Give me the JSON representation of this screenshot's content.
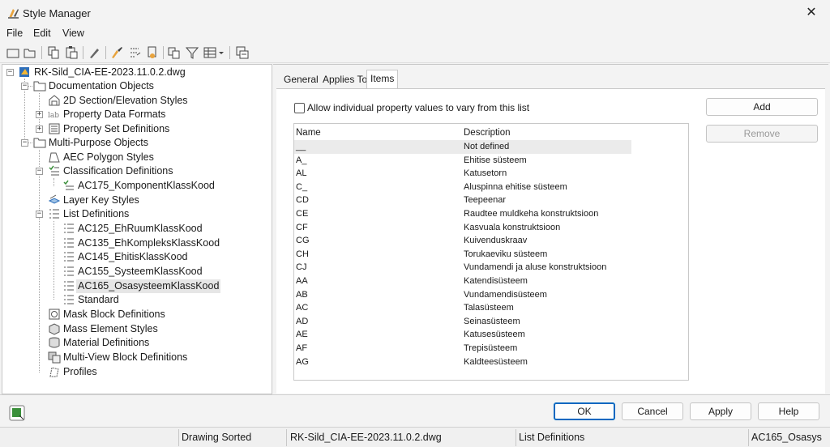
{
  "window": {
    "title": "Style Manager",
    "close_glyph": "✕"
  },
  "menu": [
    "File",
    "Edit",
    "View"
  ],
  "toolbar": {
    "icons": [
      "new-drawing-icon",
      "open-drawing-icon",
      "copy-icon",
      "paste-icon",
      "edit-style-icon",
      "purge-icon",
      "toggle-view-icon",
      "sort-icon",
      "filter-icon",
      "view-list-icon",
      "chevron-down-icon",
      "inline-edit-icon"
    ]
  },
  "tree": {
    "root": "RK-Sild_CIA-EE-2023.11.0.2.dwg",
    "doc_objects": "Documentation Objects",
    "section_styles": "2D Section/Elevation Styles",
    "property_data_formats": "Property Data Formats",
    "property_set_defs": "Property Set Definitions",
    "multi_purpose": "Multi-Purpose Objects",
    "aec_polygon": "AEC Polygon Styles",
    "classification": "Classification Definitions",
    "ac175": "AC175_KomponentKlassKood",
    "layer_key": "Layer Key Styles",
    "list_defs": "List Definitions",
    "ac125": "AC125_EhRuumKlassKood",
    "ac135": "AC135_EhKompleksKlassKood",
    "ac145": "AC145_EhitisKlassKood",
    "ac155": "AC155_SysteemKlassKood",
    "ac165": "AC165_OsasysteemKlassKood",
    "standard": "Standard",
    "mask_block": "Mask Block Definitions",
    "mass_element": "Mass Element Styles",
    "material_defs": "Material Definitions",
    "multi_view": "Multi-View Block Definitions",
    "profiles": "Profiles"
  },
  "tabs": {
    "general": "General",
    "applies_to": "Applies To",
    "items": "Items"
  },
  "items_panel": {
    "checkbox_label": "Allow individual property values to vary from this list",
    "add_label": "Add",
    "remove_label": "Remove",
    "col_name": "Name",
    "col_desc": "Description",
    "rows": [
      {
        "name": "__",
        "desc": "Not defined"
      },
      {
        "name": "A_",
        "desc": "Ehitise süsteem"
      },
      {
        "name": "AL",
        "desc": "Katusetorn"
      },
      {
        "name": "C_",
        "desc": "Aluspinna ehitise süsteem"
      },
      {
        "name": "CD",
        "desc": "Teepeenar"
      },
      {
        "name": "CE",
        "desc": "Raudtee muldkeha konstruktsioon"
      },
      {
        "name": "CF",
        "desc": "Kasvuala konstruktsioon"
      },
      {
        "name": "CG",
        "desc": "Kuivenduskraav"
      },
      {
        "name": "CH",
        "desc": "Torukaeviku süsteem"
      },
      {
        "name": "CJ",
        "desc": "Vundamendi ja aluse konstruktsioon"
      },
      {
        "name": "AA",
        "desc": "Katendisüsteem"
      },
      {
        "name": "AB",
        "desc": "Vundamendisüsteem"
      },
      {
        "name": "AC",
        "desc": "Talasüsteem"
      },
      {
        "name": "AD",
        "desc": "Seinasüsteem"
      },
      {
        "name": "AE",
        "desc": "Katusesüsteem"
      },
      {
        "name": "AF",
        "desc": "Trepisüsteem"
      },
      {
        "name": "AG",
        "desc": "Kaldteesüsteem"
      }
    ]
  },
  "buttons": {
    "ok": "OK",
    "cancel": "Cancel",
    "apply": "Apply",
    "help": "Help"
  },
  "status": {
    "sort": "Drawing Sorted",
    "file": "RK-Sild_CIA-EE-2023.11.0.2.dwg",
    "category": "List Definitions",
    "item": "AC165_Osasys"
  }
}
